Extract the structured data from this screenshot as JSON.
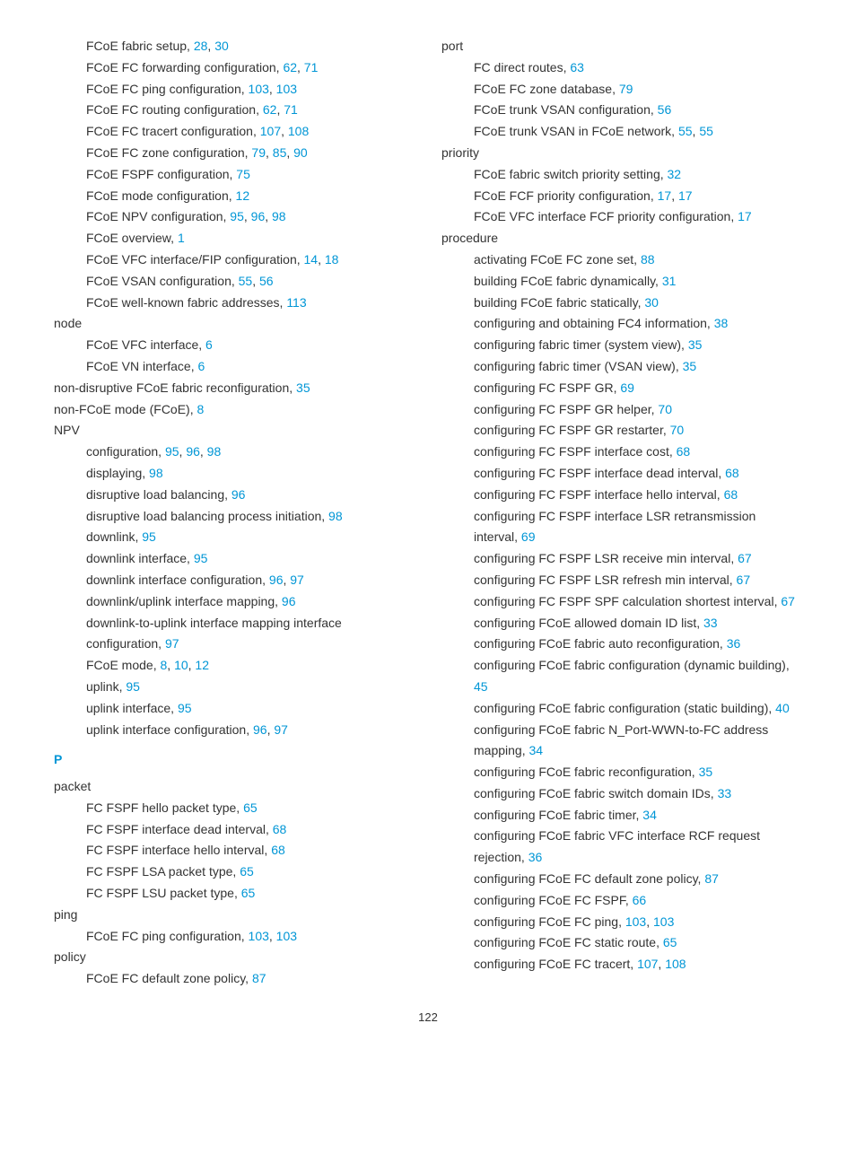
{
  "page_number": "122",
  "left": [
    {
      "lvl": 1,
      "text": "FCoE fabric setup, ",
      "pages": [
        "28",
        "30"
      ]
    },
    {
      "lvl": 1,
      "text": "FCoE FC forwarding configuration, ",
      "pages": [
        "62",
        "71"
      ]
    },
    {
      "lvl": 1,
      "text": "FCoE FC ping configuration, ",
      "pages": [
        "103",
        "103"
      ]
    },
    {
      "lvl": 1,
      "text": "FCoE FC routing configuration, ",
      "pages": [
        "62",
        "71"
      ]
    },
    {
      "lvl": 1,
      "text": "FCoE FC tracert configuration, ",
      "pages": [
        "107",
        "108"
      ]
    },
    {
      "lvl": 1,
      "text": "FCoE FC zone configuration, ",
      "pages": [
        "79",
        "85",
        "90"
      ]
    },
    {
      "lvl": 1,
      "text": "FCoE FSPF configuration, ",
      "pages": [
        "75"
      ]
    },
    {
      "lvl": 1,
      "text": "FCoE mode configuration, ",
      "pages": [
        "12"
      ]
    },
    {
      "lvl": 1,
      "text": "FCoE NPV configuration, ",
      "pages": [
        "95",
        "96",
        "98"
      ]
    },
    {
      "lvl": 1,
      "text": "FCoE overview, ",
      "pages": [
        "1"
      ]
    },
    {
      "lvl": 1,
      "text": "FCoE VFC interface/FIP configuration, ",
      "pages": [
        "14",
        "18"
      ]
    },
    {
      "lvl": 1,
      "text": "FCoE VSAN configuration, ",
      "pages": [
        "55",
        "56"
      ]
    },
    {
      "lvl": 1,
      "text": "FCoE well-known fabric addresses, ",
      "pages": [
        "113"
      ]
    },
    {
      "lvl": 0,
      "text": "node",
      "pages": []
    },
    {
      "lvl": 1,
      "text": "FCoE VFC interface, ",
      "pages": [
        "6"
      ]
    },
    {
      "lvl": 1,
      "text": "FCoE VN interface, ",
      "pages": [
        "6"
      ]
    },
    {
      "lvl": 0,
      "text": "non-disruptive FCoE fabric reconfiguration, ",
      "pages": [
        "35"
      ]
    },
    {
      "lvl": 0,
      "text": "non-FCoE mode (FCoE), ",
      "pages": [
        "8"
      ]
    },
    {
      "lvl": 0,
      "text": "NPV",
      "pages": []
    },
    {
      "lvl": 1,
      "text": "configuration, ",
      "pages": [
        "95",
        "96",
        "98"
      ]
    },
    {
      "lvl": 1,
      "text": "displaying, ",
      "pages": [
        "98"
      ]
    },
    {
      "lvl": 1,
      "text": "disruptive load balancing, ",
      "pages": [
        "96"
      ]
    },
    {
      "lvl": 1,
      "text": "disruptive load balancing process initiation, ",
      "pages": [
        "98"
      ]
    },
    {
      "lvl": 1,
      "text": "downlink, ",
      "pages": [
        "95"
      ]
    },
    {
      "lvl": 1,
      "text": "downlink interface, ",
      "pages": [
        "95"
      ]
    },
    {
      "lvl": 1,
      "text": "downlink interface configuration, ",
      "pages": [
        "96",
        "97"
      ]
    },
    {
      "lvl": 1,
      "text": "downlink/uplink interface mapping, ",
      "pages": [
        "96"
      ]
    },
    {
      "lvl": 1,
      "text": "downlink-to-uplink interface mapping interface configuration, ",
      "pages": [
        "97"
      ]
    },
    {
      "lvl": 1,
      "text": "FCoE mode, ",
      "pages": [
        "8",
        "10",
        "12"
      ]
    },
    {
      "lvl": 1,
      "text": "uplink, ",
      "pages": [
        "95"
      ]
    },
    {
      "lvl": 1,
      "text": "uplink interface, ",
      "pages": [
        "95"
      ]
    },
    {
      "lvl": 1,
      "text": "uplink interface configuration, ",
      "pages": [
        "96",
        "97"
      ]
    },
    {
      "section": "P"
    },
    {
      "lvl": 0,
      "text": "packet",
      "pages": []
    },
    {
      "lvl": 1,
      "text": "FC FSPF hello packet type, ",
      "pages": [
        "65"
      ]
    },
    {
      "lvl": 1,
      "text": "FC FSPF interface dead interval, ",
      "pages": [
        "68"
      ]
    },
    {
      "lvl": 1,
      "text": "FC FSPF interface hello interval, ",
      "pages": [
        "68"
      ]
    },
    {
      "lvl": 1,
      "text": "FC FSPF LSA packet type, ",
      "pages": [
        "65"
      ]
    },
    {
      "lvl": 1,
      "text": "FC FSPF LSU packet type, ",
      "pages": [
        "65"
      ]
    },
    {
      "lvl": 0,
      "text": "ping",
      "pages": []
    },
    {
      "lvl": 1,
      "text": "FCoE FC ping configuration, ",
      "pages": [
        "103",
        "103"
      ]
    },
    {
      "lvl": 0,
      "text": "policy",
      "pages": []
    },
    {
      "lvl": 1,
      "text": "FCoE FC default zone policy, ",
      "pages": [
        "87"
      ]
    }
  ],
  "right": [
    {
      "lvl": 0,
      "text": "port",
      "pages": []
    },
    {
      "lvl": 1,
      "text": "FC direct routes, ",
      "pages": [
        "63"
      ]
    },
    {
      "lvl": 1,
      "text": "FCoE FC zone database, ",
      "pages": [
        "79"
      ]
    },
    {
      "lvl": 1,
      "text": "FCoE trunk VSAN configuration, ",
      "pages": [
        "56"
      ]
    },
    {
      "lvl": 1,
      "text": "FCoE trunk VSAN in FCoE network, ",
      "pages": [
        "55",
        "55"
      ]
    },
    {
      "lvl": 0,
      "text": "priority",
      "pages": []
    },
    {
      "lvl": 1,
      "text": "FCoE fabric switch priority setting, ",
      "pages": [
        "32"
      ]
    },
    {
      "lvl": 1,
      "text": "FCoE FCF priority configuration, ",
      "pages": [
        "17",
        "17"
      ]
    },
    {
      "lvl": 1,
      "text": "FCoE VFC interface FCF priority configuration, ",
      "pages": [
        "17"
      ]
    },
    {
      "lvl": 0,
      "text": "procedure",
      "pages": []
    },
    {
      "lvl": 1,
      "text": "activating FCoE FC zone set, ",
      "pages": [
        "88"
      ]
    },
    {
      "lvl": 1,
      "text": "building FCoE fabric dynamically, ",
      "pages": [
        "31"
      ]
    },
    {
      "lvl": 1,
      "text": "building FCoE fabric statically, ",
      "pages": [
        "30"
      ]
    },
    {
      "lvl": 1,
      "text": "configuring and obtaining FC4 information, ",
      "pages": [
        "38"
      ]
    },
    {
      "lvl": 1,
      "text": "configuring fabric timer (system view), ",
      "pages": [
        "35"
      ]
    },
    {
      "lvl": 1,
      "text": "configuring fabric timer (VSAN view), ",
      "pages": [
        "35"
      ]
    },
    {
      "lvl": 1,
      "text": "configuring FC FSPF GR, ",
      "pages": [
        "69"
      ]
    },
    {
      "lvl": 1,
      "text": "configuring FC FSPF GR helper, ",
      "pages": [
        "70"
      ]
    },
    {
      "lvl": 1,
      "text": "configuring FC FSPF GR restarter, ",
      "pages": [
        "70"
      ]
    },
    {
      "lvl": 1,
      "text": "configuring FC FSPF interface cost, ",
      "pages": [
        "68"
      ]
    },
    {
      "lvl": 1,
      "text": "configuring FC FSPF interface dead interval, ",
      "pages": [
        "68"
      ]
    },
    {
      "lvl": 1,
      "text": "configuring FC FSPF interface hello interval, ",
      "pages": [
        "68"
      ]
    },
    {
      "lvl": 1,
      "text": "configuring FC FSPF interface LSR retransmission interval, ",
      "pages": [
        "69"
      ]
    },
    {
      "lvl": 1,
      "text": "configuring FC FSPF LSR receive min interval, ",
      "pages": [
        "67"
      ]
    },
    {
      "lvl": 1,
      "text": "configuring FC FSPF LSR refresh min interval, ",
      "pages": [
        "67"
      ]
    },
    {
      "lvl": 1,
      "text": "configuring FC FSPF SPF calculation shortest interval, ",
      "pages": [
        "67"
      ]
    },
    {
      "lvl": 1,
      "text": "configuring FCoE allowed domain ID list, ",
      "pages": [
        "33"
      ]
    },
    {
      "lvl": 1,
      "text": "configuring FCoE fabric auto reconfiguration, ",
      "pages": [
        "36"
      ]
    },
    {
      "lvl": 1,
      "text": "configuring FCoE fabric configuration (dynamic building), ",
      "pages": [
        "45"
      ]
    },
    {
      "lvl": 1,
      "text": "configuring FCoE fabric configuration (static building), ",
      "pages": [
        "40"
      ]
    },
    {
      "lvl": 1,
      "text": "configuring FCoE fabric N_Port-WWN-to-FC address mapping, ",
      "pages": [
        "34"
      ]
    },
    {
      "lvl": 1,
      "text": "configuring FCoE fabric reconfiguration, ",
      "pages": [
        "35"
      ]
    },
    {
      "lvl": 1,
      "text": "configuring FCoE fabric switch domain IDs, ",
      "pages": [
        "33"
      ]
    },
    {
      "lvl": 1,
      "text": "configuring FCoE fabric timer, ",
      "pages": [
        "34"
      ]
    },
    {
      "lvl": 1,
      "text": "configuring FCoE fabric VFC interface RCF request rejection, ",
      "pages": [
        "36"
      ]
    },
    {
      "lvl": 1,
      "text": "configuring FCoE FC default zone policy, ",
      "pages": [
        "87"
      ]
    },
    {
      "lvl": 1,
      "text": "configuring FCoE FC FSPF, ",
      "pages": [
        "66"
      ]
    },
    {
      "lvl": 1,
      "text": "configuring FCoE FC ping, ",
      "pages": [
        "103",
        "103"
      ]
    },
    {
      "lvl": 1,
      "text": "configuring FCoE FC static route, ",
      "pages": [
        "65"
      ]
    },
    {
      "lvl": 1,
      "text": "configuring FCoE FC tracert, ",
      "pages": [
        "107",
        "108"
      ]
    }
  ]
}
